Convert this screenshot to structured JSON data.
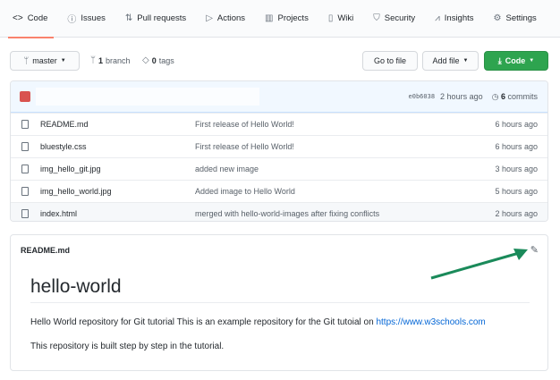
{
  "tabs": [
    {
      "label": "Code",
      "icon": "code-icon"
    },
    {
      "label": "Issues",
      "icon": "issue-icon"
    },
    {
      "label": "Pull requests",
      "icon": "pull-request-icon"
    },
    {
      "label": "Actions",
      "icon": "play-icon"
    },
    {
      "label": "Projects",
      "icon": "project-icon"
    },
    {
      "label": "Wiki",
      "icon": "book-icon"
    },
    {
      "label": "Security",
      "icon": "shield-icon"
    },
    {
      "label": "Insights",
      "icon": "graph-icon"
    },
    {
      "label": "Settings",
      "icon": "gear-icon"
    }
  ],
  "toolbar": {
    "branch": "master",
    "branch_count": "1",
    "branch_label": "branch",
    "tag_count": "0",
    "tag_label": "tags",
    "go_to_file": "Go to file",
    "add_file": "Add file",
    "code": "Code"
  },
  "commit": {
    "hash": "e0b6038",
    "time": "2 hours ago",
    "count": "6",
    "count_label": "commits"
  },
  "files": [
    {
      "name": "README.md",
      "message": "First release of Hello World!",
      "age": "6 hours ago"
    },
    {
      "name": "bluestyle.css",
      "message": "First release of Hello World!",
      "age": "6 hours ago"
    },
    {
      "name": "img_hello_git.jpg",
      "message": "added new image",
      "age": "3 hours ago"
    },
    {
      "name": "img_hello_world.jpg",
      "message": "Added image to Hello World",
      "age": "5 hours ago"
    },
    {
      "name": "index.html",
      "message": "merged with hello-world-images after fixing conflicts",
      "age": "2 hours ago"
    }
  ],
  "readme": {
    "filename": "README.md",
    "title": "hello-world",
    "para1": "Hello World repository for Git tutorial This is an example repository for the Git tutoial on",
    "link": "https://www.w3schools.com",
    "para2": "This repository is built step by step in the tutorial."
  },
  "colors": {
    "accent_green": "#2ea44f",
    "tab_underline": "#f9826c",
    "arrow": "#1a8a5a",
    "link": "#0366d6"
  }
}
